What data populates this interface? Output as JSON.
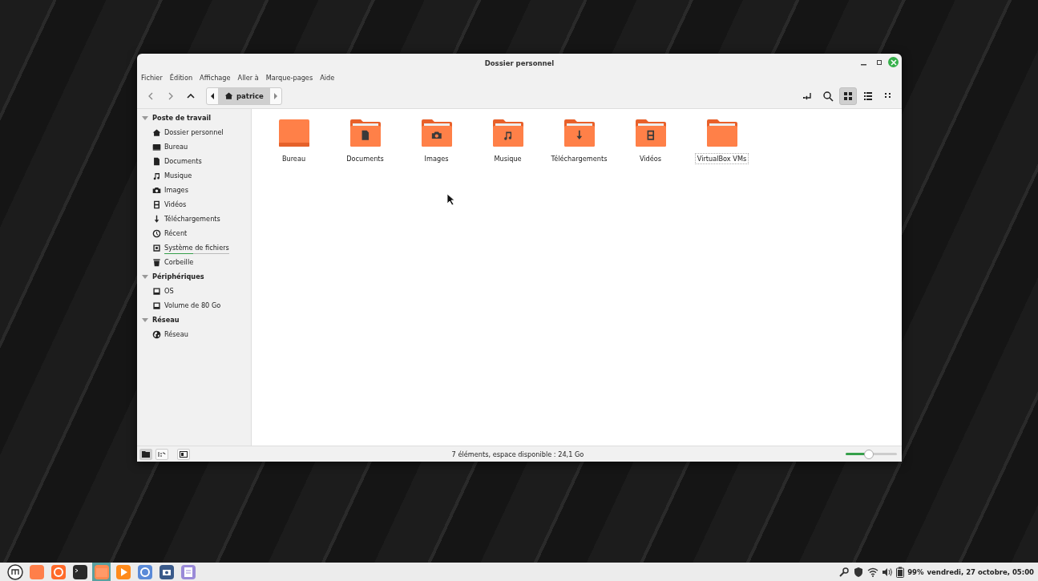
{
  "window": {
    "title": "Dossier personnel"
  },
  "menu": [
    "Fichier",
    "Édition",
    "Affichage",
    "Aller à",
    "Marque-pages",
    "Aide"
  ],
  "path": {
    "label": "patrice"
  },
  "view_buttons": [
    {
      "kind": "grid",
      "selected": true
    },
    {
      "kind": "list",
      "selected": false
    },
    {
      "kind": "compact",
      "selected": false
    }
  ],
  "sidebar": [
    {
      "title": "Poste de travail",
      "expanded": true,
      "items": [
        {
          "label": "Dossier personnel",
          "kind": "home"
        },
        {
          "label": "Bureau",
          "kind": "desktop"
        },
        {
          "label": "Documents",
          "kind": "document"
        },
        {
          "label": "Musique",
          "kind": "music"
        },
        {
          "label": "Images",
          "kind": "camera"
        },
        {
          "label": "Vidéos",
          "kind": "film"
        },
        {
          "label": "Téléchargements",
          "kind": "download"
        },
        {
          "label": "Récent",
          "kind": "clock"
        },
        {
          "label": "Système de fichiers",
          "kind": "drive",
          "level": 0.45
        },
        {
          "label": "Corbeille",
          "kind": "trash"
        }
      ]
    },
    {
      "title": "Périphériques",
      "expanded": true,
      "items": [
        {
          "label": "OS",
          "kind": "disk"
        },
        {
          "label": "Volume de 80 Go",
          "kind": "disk"
        }
      ]
    },
    {
      "title": "Réseau",
      "expanded": true,
      "items": [
        {
          "label": "Réseau",
          "kind": "globe"
        }
      ]
    }
  ],
  "files": [
    {
      "name": "Bureau",
      "kind": "desktop",
      "selected": false
    },
    {
      "name": "Documents",
      "kind": "document",
      "selected": false
    },
    {
      "name": "Images",
      "kind": "camera",
      "selected": false
    },
    {
      "name": "Musique",
      "kind": "music",
      "selected": false
    },
    {
      "name": "Téléchargements",
      "kind": "download",
      "selected": false
    },
    {
      "name": "Vidéos",
      "kind": "film",
      "selected": false
    },
    {
      "name": "VirtualBox VMs",
      "kind": "folder",
      "selected": true
    }
  ],
  "status_bar": {
    "text": "7 éléments, espace disponible : 24,1 Go",
    "zoom": {
      "level": 0.45
    }
  },
  "taskbar": {
    "apps": [
      {
        "kind": "menu",
        "active": false
      },
      {
        "kind": "desktop",
        "active": false
      },
      {
        "kind": "firefox",
        "active": false
      },
      {
        "kind": "terminal",
        "active": false
      },
      {
        "kind": "files",
        "active": true
      },
      {
        "kind": "player",
        "active": false
      },
      {
        "kind": "browser",
        "active": false
      },
      {
        "kind": "screenshot",
        "active": false
      },
      {
        "kind": "notes",
        "active": false
      }
    ],
    "battery": "99%",
    "clock": "vendredi, 27 octobre, 05:00"
  }
}
